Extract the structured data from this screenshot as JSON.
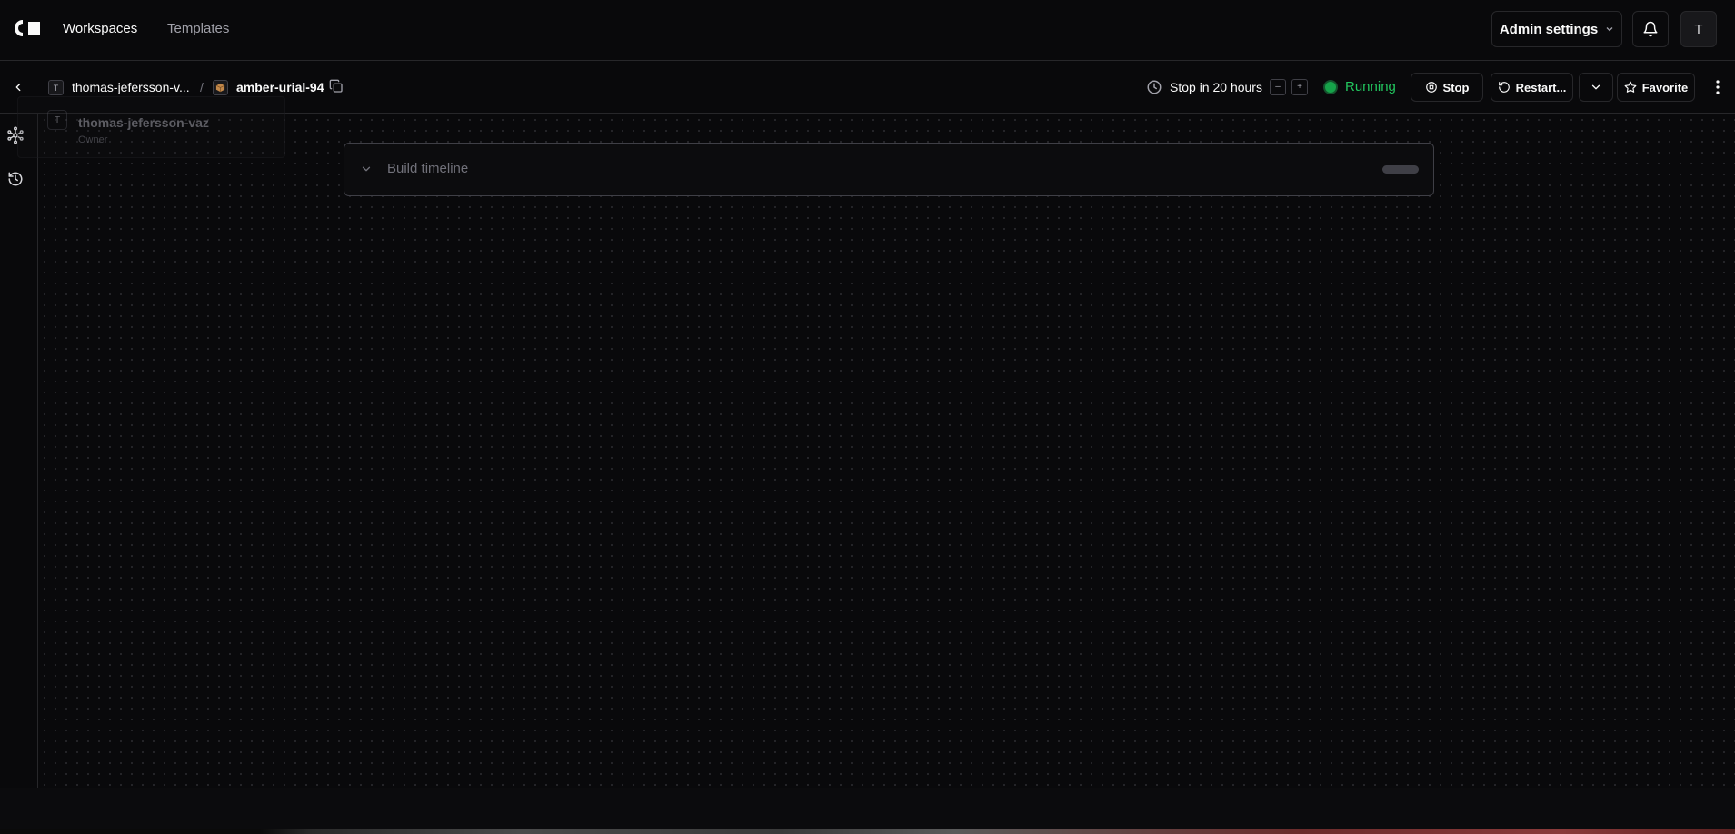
{
  "topnav": {
    "logo": "coder-logo",
    "workspaces_label": "Workspaces",
    "templates_label": "Templates",
    "admin_label": "Admin settings",
    "user_initial": "T"
  },
  "breadcrumb": {
    "org_initial": "T",
    "org_name": "thomas-jefersson-v...",
    "separator": "/",
    "workspace_name": "amber-urial-94"
  },
  "schedule": {
    "label": "Stop in 20 hours",
    "decrease": "–",
    "increase": "+"
  },
  "status": {
    "label": "Running",
    "color": "#22c55e"
  },
  "actions": {
    "stop_label": "Stop",
    "restart_label": "Restart...",
    "favorite_label": "Favorite"
  },
  "owner_popover": {
    "initial": "T",
    "name": "thomas-jefersson-vaz",
    "role": "Owner"
  },
  "timeline": {
    "label": "Build timeline"
  }
}
